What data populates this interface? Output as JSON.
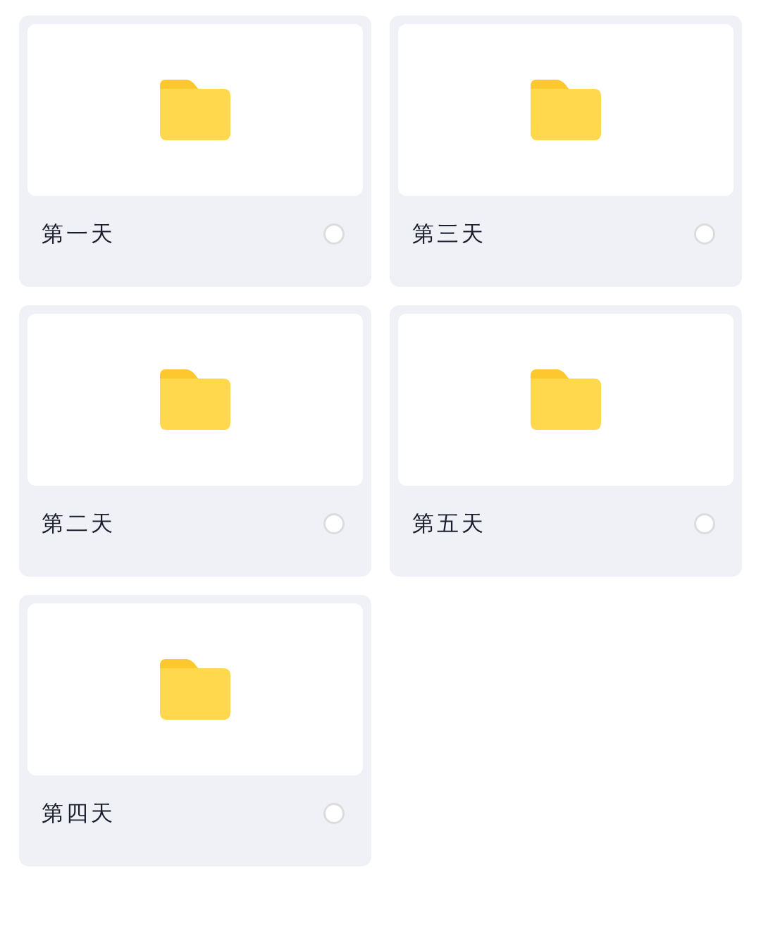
{
  "folders": [
    {
      "name": "第一天",
      "selected": false
    },
    {
      "name": "第三天",
      "selected": false
    },
    {
      "name": "第二天",
      "selected": false
    },
    {
      "name": "第五天",
      "selected": false
    },
    {
      "name": "第四天",
      "selected": false
    }
  ]
}
